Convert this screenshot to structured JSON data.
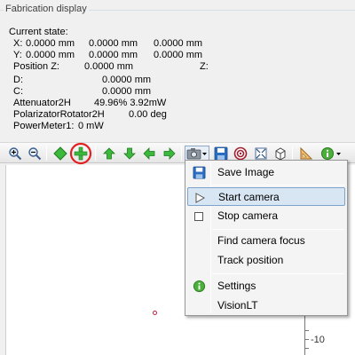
{
  "group": {
    "title": "Fabrication display"
  },
  "state": {
    "heading": "Current state:",
    "x_label": "X:",
    "x1": "0.0000 mm",
    "x2": "0.0000 mm",
    "x3": "0.0000 mm",
    "y_label": "Y:",
    "y1": "0.0000 mm",
    "y2": "0.0000 mm",
    "y3": "0.0000 mm",
    "posz_label": "Position Z:",
    "posz_val": "0.0000 mm",
    "z_label": "Z:",
    "d_label": "D:",
    "d_val": "0.0000 mm",
    "c_label": "C:",
    "c_val": "0.0000 mm",
    "att_label": "Attenuator2H",
    "att_val": "49.96% 3.92mW",
    "pol_label": "PolarizatorRotator2H",
    "pol_val": "0.00 deg",
    "pow_label": "PowerMeter1:",
    "pow_val": "0 mW"
  },
  "toolbar": {
    "icons": [
      "zoom-in",
      "zoom-out",
      "diamond",
      "center-target",
      "arrow-up",
      "arrow-down",
      "arrow-left",
      "arrow-right",
      "camera-dropdown",
      "save",
      "target",
      "fit",
      "cube",
      "ruler",
      "info-dropdown"
    ]
  },
  "axis": {
    "tick_label": "-10"
  },
  "menu": {
    "save_image": "Save Image",
    "start_camera": "Start camera",
    "stop_camera": "Stop camera",
    "find_focus": "Find camera focus",
    "track_position": "Track position",
    "settings": "Settings",
    "visionlt": "VisionLT"
  },
  "colors": {
    "accent_green": "#3cb83c",
    "highlight_ring": "#e02020",
    "menu_highlight": "#d8e6f4"
  }
}
